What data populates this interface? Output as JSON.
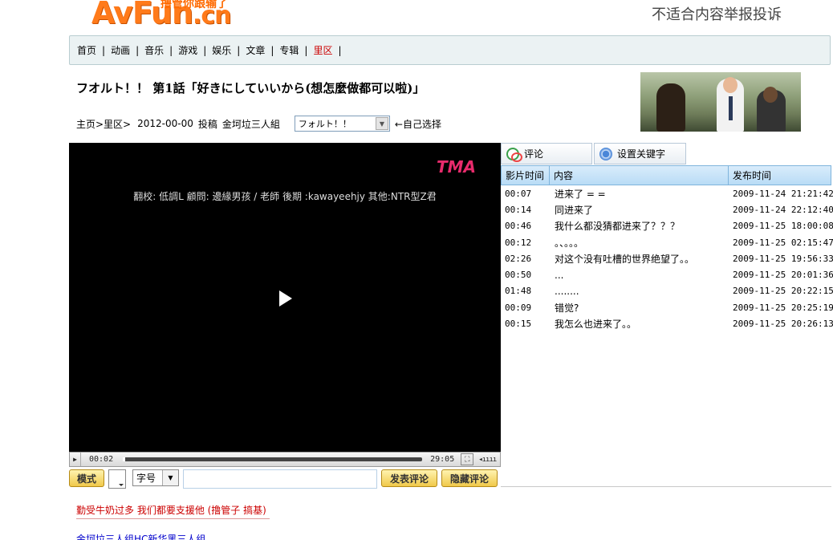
{
  "header": {
    "logo_text": "AvFun",
    "logo_suffix": ".cn",
    "logo_tagline": "撸管你跟输了",
    "report_link": "不适合内容举报投诉"
  },
  "nav": {
    "items": [
      {
        "label": "首页"
      },
      {
        "label": "动画"
      },
      {
        "label": "音乐"
      },
      {
        "label": "游戏"
      },
      {
        "label": "娱乐"
      },
      {
        "label": "文章"
      },
      {
        "label": "专辑"
      },
      {
        "label": "里区",
        "active": true
      }
    ],
    "separator": "|"
  },
  "video": {
    "title": "フオルト！！ 第1話「好きにしていいから(想怎麼做都可以啦)」",
    "breadcrumb": "主页>里区>",
    "date": "2012-00-00",
    "action": "投稿",
    "uploader": "金坷垃三人組",
    "part_select": "フォルト！！",
    "part_hint": "←自己选择"
  },
  "player": {
    "brand": "TMA",
    "credits": "翻校: 低調L 顧問: 邊緣男孩 / 老師 後期 :kawayeehjy 其他:NTR型Z君",
    "current_time": "00:02",
    "total_time": "29:05",
    "progress": 0.001
  },
  "toolbar": {
    "mode_label": "模式",
    "font_size_label": "字号",
    "input_placeholder": "",
    "post_label": "发表评论",
    "hide_label": "隐藏评论"
  },
  "comments_panel": {
    "tabs": [
      {
        "label": "评论"
      },
      {
        "label": "设置关键字"
      }
    ],
    "columns": [
      "影片时间",
      "内容",
      "发布时间"
    ],
    "rows": [
      {
        "time": "00:07",
        "content": "进来了 = =",
        "posted": "2009-11-24 21:21:42"
      },
      {
        "time": "00:14",
        "content": "同进来了",
        "posted": "2009-11-24 22:12:40"
      },
      {
        "time": "00:46",
        "content": "我什么都没猜都进来了？？？",
        "posted": "2009-11-25 18:00:08"
      },
      {
        "time": "00:12",
        "content": "。、。。。",
        "posted": "2009-11-25 02:15:47"
      },
      {
        "time": "02:26",
        "content": "对这个没有吐槽的世界绝望了。。",
        "posted": "2009-11-25 19:56:33"
      },
      {
        "time": "00:50",
        "content": "...",
        "posted": "2009-11-25 20:01:36"
      },
      {
        "time": "01:48",
        "content": "........",
        "posted": "2009-11-25 20:22:15"
      },
      {
        "time": "00:09",
        "content": "错觉?",
        "posted": "2009-11-25 20:25:19"
      },
      {
        "time": "00:15",
        "content": "我怎么也进来了。。",
        "posted": "2009-11-25 20:26:13"
      }
    ]
  },
  "footer": {
    "notice": "勤受牛奶过多 我们都要支援他 (撸管子 搞基)",
    "more_link": "金坷垃三人组HC新华黑三人组"
  }
}
